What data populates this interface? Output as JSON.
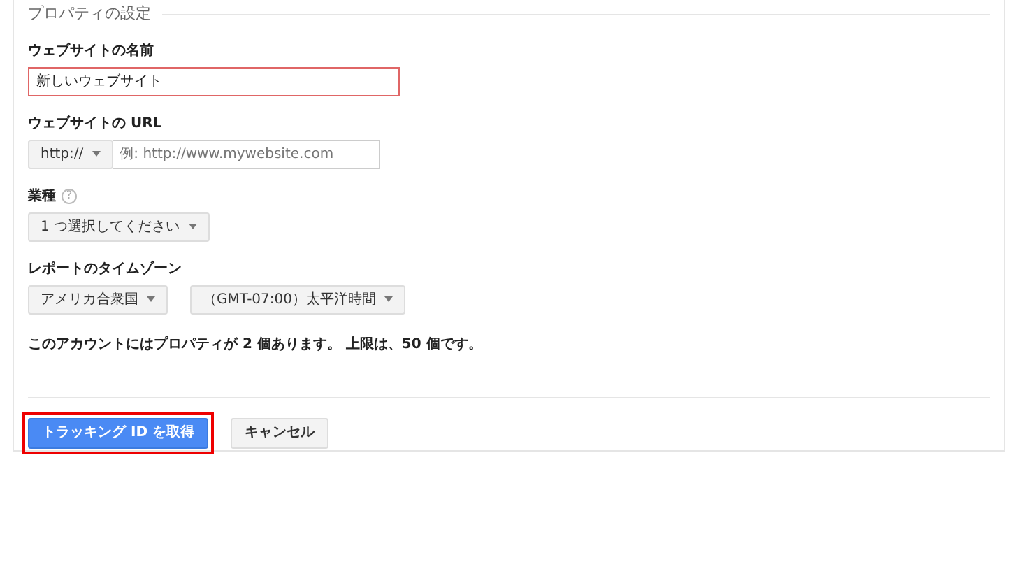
{
  "section_title": "プロパティの設定",
  "website_name": {
    "label": "ウェブサイトの名前",
    "value": "新しいウェブサイト",
    "invalid": true
  },
  "website_url": {
    "label": "ウェブサイトの URL",
    "protocol": "http://",
    "placeholder": "例: http://www.mywebsite.com"
  },
  "industry": {
    "label": "業種",
    "help": "?",
    "value": "1 つ選択してください"
  },
  "timezone": {
    "label": "レポートのタイムゾーン",
    "country": "アメリカ合衆国",
    "zone": "（GMT-07:00）太平洋時間"
  },
  "notice": "このアカウントにはプロパティが 2 個あります。 上限は、50 個です。",
  "buttons": [
    {
      "label": "トラッキング ID を取得",
      "kind": "primary",
      "highlighted": true
    },
    {
      "label": "キャンセル",
      "kind": "secondary",
      "highlighted": false
    }
  ]
}
